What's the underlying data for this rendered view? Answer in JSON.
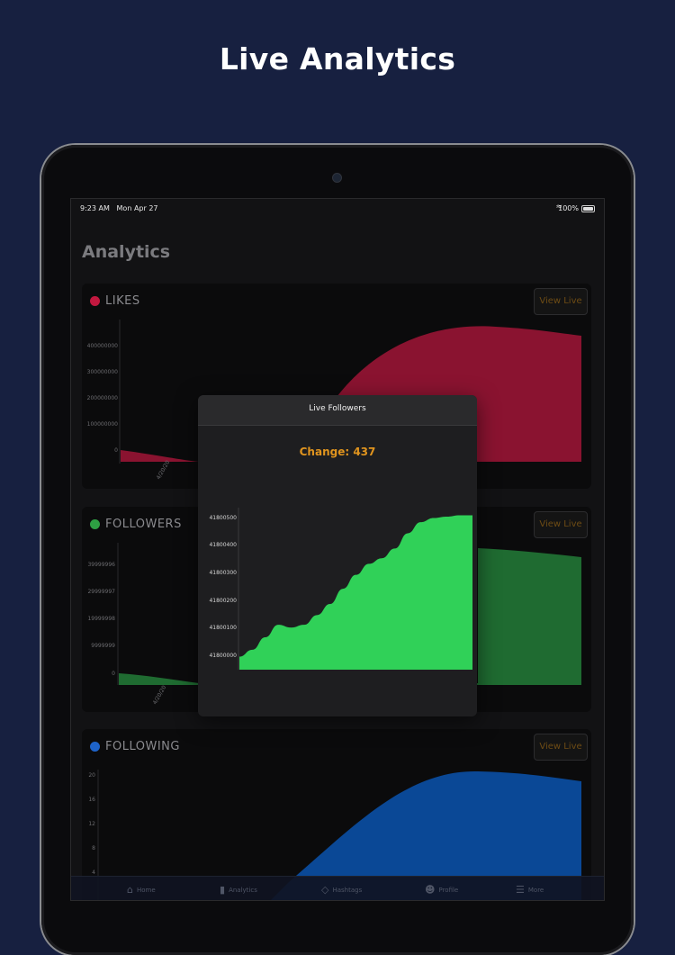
{
  "headline": "Live Analytics",
  "status_bar": {
    "time": "9:23 AM",
    "date": "Mon Apr 27",
    "battery": "100%"
  },
  "page_title": "Analytics",
  "cards": [
    {
      "title": "LIKES",
      "dot_color": "#c2183f",
      "fill_color": "#8a1330",
      "view_live": "View Live",
      "y_ticks": [
        "400000000",
        "300000000",
        "200000000",
        "100000000",
        "0"
      ],
      "x_tick": "4/20/20"
    },
    {
      "title": "FOLLOWERS",
      "dot_color": "#2ea043",
      "fill_color": "#1f6b31",
      "view_live": "View Live",
      "y_ticks": [
        "39999996",
        "29999997",
        "19999998",
        "9999999",
        "0"
      ],
      "x_tick": "4/20/20"
    },
    {
      "title": "FOLLOWING",
      "dot_color": "#1e63c9",
      "fill_color": "#0a4896",
      "view_live": "View Live",
      "y_ticks": [
        "20",
        "16",
        "12",
        "8",
        "4"
      ]
    }
  ],
  "overlay": {
    "title": "Live Followers",
    "change": "Change: 437",
    "fill_color": "#30d158"
  },
  "chart_data": {
    "type": "area",
    "title": "Live Followers",
    "y_ticks": [
      "41800500",
      "41800400",
      "41800300",
      "41800200",
      "41800100",
      "41800000"
    ],
    "ylim": [
      41800000,
      41800500
    ],
    "x": [
      0,
      1,
      2,
      3,
      4,
      5,
      6,
      7,
      8,
      9,
      10,
      11,
      12,
      13,
      14,
      15,
      16,
      17,
      18
    ],
    "values": [
      41799995,
      41800020,
      41800065,
      41800110,
      41800100,
      41800110,
      41800145,
      41800185,
      41800240,
      41800290,
      41800330,
      41800350,
      41800385,
      41800440,
      41800480,
      41800495,
      41800500,
      41800505,
      41800505
    ]
  },
  "tab_bar": [
    {
      "label": "Home",
      "icon": "home-icon"
    },
    {
      "label": "Analytics",
      "icon": "analytics-icon"
    },
    {
      "label": "Hashtags",
      "icon": "tag-icon"
    },
    {
      "label": "Profile",
      "icon": "profile-icon"
    },
    {
      "label": "More",
      "icon": "list-icon"
    }
  ]
}
